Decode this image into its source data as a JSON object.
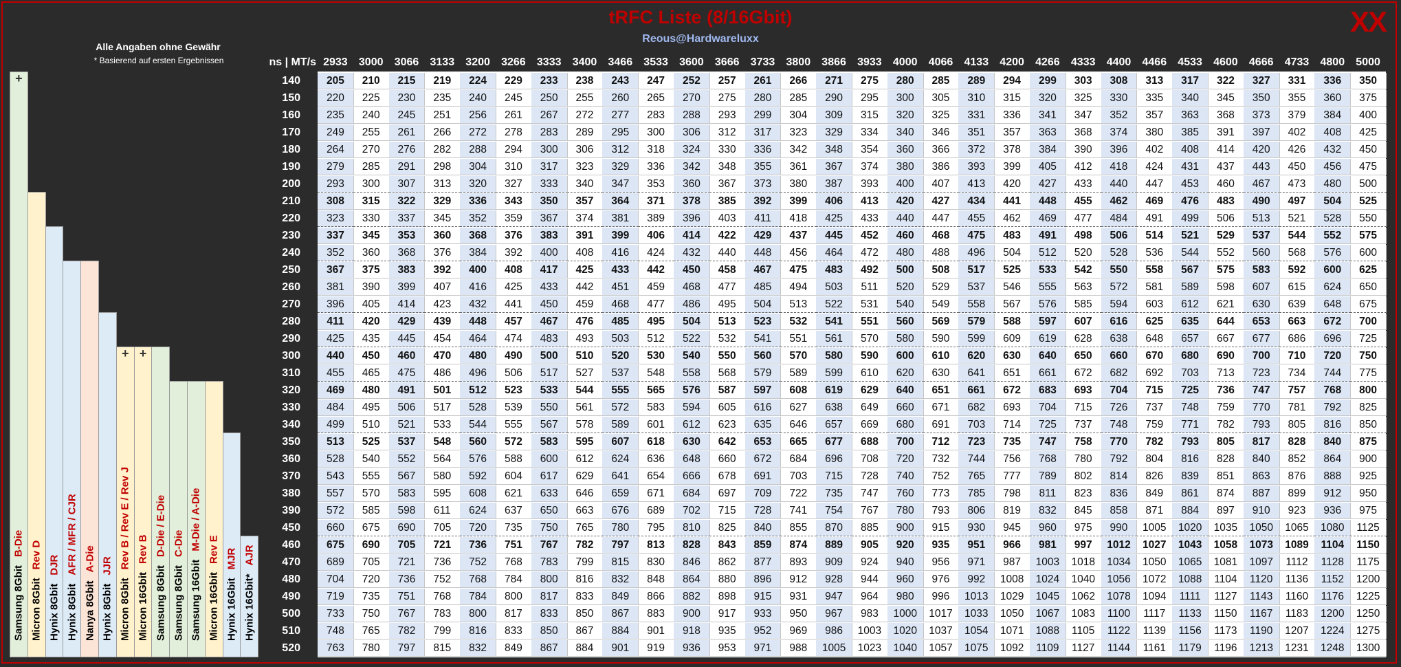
{
  "title": "tRFC Liste (8/16Gbit)",
  "subtitle": "Reous@Hardwareluxx",
  "corner_mark": "XX",
  "notes": {
    "line1": "Alle Angaben ohne Gewähr",
    "line2": "* Basierend auf ersten Ergebnissen"
  },
  "header_label": "ns | MT/s",
  "speeds": [
    "2933",
    "3000",
    "3066",
    "3133",
    "3200",
    "3266",
    "3333",
    "3400",
    "3466",
    "3533",
    "3600",
    "3666",
    "3733",
    "3800",
    "3866",
    "3933",
    "4000",
    "4066",
    "4133",
    "4200",
    "4266",
    "4333",
    "4400",
    "4466",
    "4533",
    "4600",
    "4666",
    "4733",
    "4800",
    "5000"
  ],
  "ns": [
    "140",
    "150",
    "160",
    "170",
    "180",
    "190",
    "200",
    "210",
    "220",
    "230",
    "240",
    "250",
    "260",
    "270",
    "280",
    "290",
    "300",
    "310",
    "320",
    "330",
    "340",
    "350",
    "360",
    "370",
    "380",
    "390",
    "450",
    "460",
    "470",
    "480",
    "490",
    "500",
    "510",
    "520"
  ],
  "bold_rows": [
    0,
    7,
    9,
    11,
    14,
    16,
    18,
    21,
    27
  ],
  "ics": [
    {
      "name": "Samsung 8Gbit",
      "die": "B-Die",
      "marker": "+",
      "color": "#e2efda"
    },
    {
      "name": "Micron 8Gbit",
      "die": "Rev D",
      "marker": "",
      "color": "#fff2cc"
    },
    {
      "name": "Hynix 8Gbit",
      "die": "DJR",
      "marker": "",
      "color": "#ddebf7"
    },
    {
      "name": "Hynix 8Gbit",
      "die": "AFR / MFR / CJR",
      "marker": "",
      "color": "#ddebf7"
    },
    {
      "name": "Nanya 8Gbit",
      "die": "A-Die",
      "marker": "",
      "color": "#fce4d6"
    },
    {
      "name": "Hynix 8Gbit",
      "die": "JJR",
      "marker": "",
      "color": "#ddebf7"
    },
    {
      "name": "Micron 8Gbit",
      "die": "Rev B / Rev E / Rev J",
      "marker": "+",
      "color": "#fff2cc"
    },
    {
      "name": "Micron 16Gbit",
      "die": "Rev B",
      "marker": "+",
      "color": "#fff2cc"
    },
    {
      "name": "Samsung 8Gbit",
      "die": "D-Die / E-Die",
      "marker": "",
      "color": "#e2efda"
    },
    {
      "name": "Samsung 8Gbit",
      "die": "C-Die",
      "marker": "",
      "color": "#e2efda"
    },
    {
      "name": "Samsung 16Gbit",
      "die": "M-Die / A-Die",
      "marker": "",
      "color": "#e2efda"
    },
    {
      "name": "Micron 16Gbit",
      "die": "Rev E",
      "marker": "",
      "color": "#fff2cc"
    },
    {
      "name": "Hynix 16Gbit",
      "die": "MJR",
      "marker": "",
      "color": "#ddebf7"
    },
    {
      "name": "Hynix 16Gbit*",
      "die": "AJR",
      "marker": "",
      "color": "#ddebf7"
    }
  ],
  "ic_start_rows": [
    0,
    7,
    9,
    11,
    11,
    14,
    16,
    16,
    16,
    18,
    18,
    18,
    21,
    27
  ],
  "values": [
    [
      "205",
      "210",
      "215",
      "219",
      "224",
      "229",
      "233",
      "238",
      "243",
      "247",
      "252",
      "257",
      "261",
      "266",
      "271",
      "275",
      "280",
      "285",
      "289",
      "294",
      "299",
      "303",
      "308",
      "313",
      "317",
      "322",
      "327",
      "331",
      "336",
      "350"
    ],
    [
      "220",
      "225",
      "230",
      "235",
      "240",
      "245",
      "250",
      "255",
      "260",
      "265",
      "270",
      "275",
      "280",
      "285",
      "290",
      "295",
      "300",
      "305",
      "310",
      "315",
      "320",
      "325",
      "330",
      "335",
      "340",
      "345",
      "350",
      "355",
      "360",
      "375"
    ],
    [
      "235",
      "240",
      "245",
      "251",
      "256",
      "261",
      "267",
      "272",
      "277",
      "283",
      "288",
      "293",
      "299",
      "304",
      "309",
      "315",
      "320",
      "325",
      "331",
      "336",
      "341",
      "347",
      "352",
      "357",
      "363",
      "368",
      "373",
      "379",
      "384",
      "400"
    ],
    [
      "249",
      "255",
      "261",
      "266",
      "272",
      "278",
      "283",
      "289",
      "295",
      "300",
      "306",
      "312",
      "317",
      "323",
      "329",
      "334",
      "340",
      "346",
      "351",
      "357",
      "363",
      "368",
      "374",
      "380",
      "385",
      "391",
      "397",
      "402",
      "408",
      "425"
    ],
    [
      "264",
      "270",
      "276",
      "282",
      "288",
      "294",
      "300",
      "306",
      "312",
      "318",
      "324",
      "330",
      "336",
      "342",
      "348",
      "354",
      "360",
      "366",
      "372",
      "378",
      "384",
      "390",
      "396",
      "402",
      "408",
      "414",
      "420",
      "426",
      "432",
      "450"
    ],
    [
      "279",
      "285",
      "291",
      "298",
      "304",
      "310",
      "317",
      "323",
      "329",
      "336",
      "342",
      "348",
      "355",
      "361",
      "367",
      "374",
      "380",
      "386",
      "393",
      "399",
      "405",
      "412",
      "418",
      "424",
      "431",
      "437",
      "443",
      "450",
      "456",
      "475"
    ],
    [
      "293",
      "300",
      "307",
      "313",
      "320",
      "327",
      "333",
      "340",
      "347",
      "353",
      "360",
      "367",
      "373",
      "380",
      "387",
      "393",
      "400",
      "407",
      "413",
      "420",
      "427",
      "433",
      "440",
      "447",
      "453",
      "460",
      "467",
      "473",
      "480",
      "500"
    ],
    [
      "308",
      "315",
      "322",
      "329",
      "336",
      "343",
      "350",
      "357",
      "364",
      "371",
      "378",
      "385",
      "392",
      "399",
      "406",
      "413",
      "420",
      "427",
      "434",
      "441",
      "448",
      "455",
      "462",
      "469",
      "476",
      "483",
      "490",
      "497",
      "504",
      "525"
    ],
    [
      "323",
      "330",
      "337",
      "345",
      "352",
      "359",
      "367",
      "374",
      "381",
      "389",
      "396",
      "403",
      "411",
      "418",
      "425",
      "433",
      "440",
      "447",
      "455",
      "462",
      "469",
      "477",
      "484",
      "491",
      "499",
      "506",
      "513",
      "521",
      "528",
      "550"
    ],
    [
      "337",
      "345",
      "353",
      "360",
      "368",
      "376",
      "383",
      "391",
      "399",
      "406",
      "414",
      "422",
      "429",
      "437",
      "445",
      "452",
      "460",
      "468",
      "475",
      "483",
      "491",
      "498",
      "506",
      "514",
      "521",
      "529",
      "537",
      "544",
      "552",
      "575"
    ],
    [
      "352",
      "360",
      "368",
      "376",
      "384",
      "392",
      "400",
      "408",
      "416",
      "424",
      "432",
      "440",
      "448",
      "456",
      "464",
      "472",
      "480",
      "488",
      "496",
      "504",
      "512",
      "520",
      "528",
      "536",
      "544",
      "552",
      "560",
      "568",
      "576",
      "600"
    ],
    [
      "367",
      "375",
      "383",
      "392",
      "400",
      "408",
      "417",
      "425",
      "433",
      "442",
      "450",
      "458",
      "467",
      "475",
      "483",
      "492",
      "500",
      "508",
      "517",
      "525",
      "533",
      "542",
      "550",
      "558",
      "567",
      "575",
      "583",
      "592",
      "600",
      "625"
    ],
    [
      "381",
      "390",
      "399",
      "407",
      "416",
      "425",
      "433",
      "442",
      "451",
      "459",
      "468",
      "477",
      "485",
      "494",
      "503",
      "511",
      "520",
      "529",
      "537",
      "546",
      "555",
      "563",
      "572",
      "581",
      "589",
      "598",
      "607",
      "615",
      "624",
      "650"
    ],
    [
      "396",
      "405",
      "414",
      "423",
      "432",
      "441",
      "450",
      "459",
      "468",
      "477",
      "486",
      "495",
      "504",
      "513",
      "522",
      "531",
      "540",
      "549",
      "558",
      "567",
      "576",
      "585",
      "594",
      "603",
      "612",
      "621",
      "630",
      "639",
      "648",
      "675"
    ],
    [
      "411",
      "420",
      "429",
      "439",
      "448",
      "457",
      "467",
      "476",
      "485",
      "495",
      "504",
      "513",
      "523",
      "532",
      "541",
      "551",
      "560",
      "569",
      "579",
      "588",
      "597",
      "607",
      "616",
      "625",
      "635",
      "644",
      "653",
      "663",
      "672",
      "700"
    ],
    [
      "425",
      "435",
      "445",
      "454",
      "464",
      "474",
      "483",
      "493",
      "503",
      "512",
      "522",
      "532",
      "541",
      "551",
      "561",
      "570",
      "580",
      "590",
      "599",
      "609",
      "619",
      "628",
      "638",
      "648",
      "657",
      "667",
      "677",
      "686",
      "696",
      "725"
    ],
    [
      "440",
      "450",
      "460",
      "470",
      "480",
      "490",
      "500",
      "510",
      "520",
      "530",
      "540",
      "550",
      "560",
      "570",
      "580",
      "590",
      "600",
      "610",
      "620",
      "630",
      "640",
      "650",
      "660",
      "670",
      "680",
      "690",
      "700",
      "710",
      "720",
      "750"
    ],
    [
      "455",
      "465",
      "475",
      "486",
      "496",
      "506",
      "517",
      "527",
      "537",
      "548",
      "558",
      "568",
      "579",
      "589",
      "599",
      "610",
      "620",
      "630",
      "641",
      "651",
      "661",
      "672",
      "682",
      "692",
      "703",
      "713",
      "723",
      "734",
      "744",
      "775"
    ],
    [
      "469",
      "480",
      "491",
      "501",
      "512",
      "523",
      "533",
      "544",
      "555",
      "565",
      "576",
      "587",
      "597",
      "608",
      "619",
      "629",
      "640",
      "651",
      "661",
      "672",
      "683",
      "693",
      "704",
      "715",
      "725",
      "736",
      "747",
      "757",
      "768",
      "800"
    ],
    [
      "484",
      "495",
      "506",
      "517",
      "528",
      "539",
      "550",
      "561",
      "572",
      "583",
      "594",
      "605",
      "616",
      "627",
      "638",
      "649",
      "660",
      "671",
      "682",
      "693",
      "704",
      "715",
      "726",
      "737",
      "748",
      "759",
      "770",
      "781",
      "792",
      "825"
    ],
    [
      "499",
      "510",
      "521",
      "533",
      "544",
      "555",
      "567",
      "578",
      "589",
      "601",
      "612",
      "623",
      "635",
      "646",
      "657",
      "669",
      "680",
      "691",
      "703",
      "714",
      "725",
      "737",
      "748",
      "759",
      "771",
      "782",
      "793",
      "805",
      "816",
      "850"
    ],
    [
      "513",
      "525",
      "537",
      "548",
      "560",
      "572",
      "583",
      "595",
      "607",
      "618",
      "630",
      "642",
      "653",
      "665",
      "677",
      "688",
      "700",
      "712",
      "723",
      "735",
      "747",
      "758",
      "770",
      "782",
      "793",
      "805",
      "817",
      "828",
      "840",
      "875"
    ],
    [
      "528",
      "540",
      "552",
      "564",
      "576",
      "588",
      "600",
      "612",
      "624",
      "636",
      "648",
      "660",
      "672",
      "684",
      "696",
      "708",
      "720",
      "732",
      "744",
      "756",
      "768",
      "780",
      "792",
      "804",
      "816",
      "828",
      "840",
      "852",
      "864",
      "900"
    ],
    [
      "543",
      "555",
      "567",
      "580",
      "592",
      "604",
      "617",
      "629",
      "641",
      "654",
      "666",
      "678",
      "691",
      "703",
      "715",
      "728",
      "740",
      "752",
      "765",
      "777",
      "789",
      "802",
      "814",
      "826",
      "839",
      "851",
      "863",
      "876",
      "888",
      "925"
    ],
    [
      "557",
      "570",
      "583",
      "595",
      "608",
      "621",
      "633",
      "646",
      "659",
      "671",
      "684",
      "697",
      "709",
      "722",
      "735",
      "747",
      "760",
      "773",
      "785",
      "798",
      "811",
      "823",
      "836",
      "849",
      "861",
      "874",
      "887",
      "899",
      "912",
      "950"
    ],
    [
      "572",
      "585",
      "598",
      "611",
      "624",
      "637",
      "650",
      "663",
      "676",
      "689",
      "702",
      "715",
      "728",
      "741",
      "754",
      "767",
      "780",
      "793",
      "806",
      "819",
      "832",
      "845",
      "858",
      "871",
      "884",
      "897",
      "910",
      "923",
      "936",
      "975"
    ],
    [
      "660",
      "675",
      "690",
      "705",
      "720",
      "735",
      "750",
      "765",
      "780",
      "795",
      "810",
      "825",
      "840",
      "855",
      "870",
      "885",
      "900",
      "915",
      "930",
      "945",
      "960",
      "975",
      "990",
      "1005",
      "1020",
      "1035",
      "1050",
      "1065",
      "1080",
      "1125"
    ],
    [
      "675",
      "690",
      "705",
      "721",
      "736",
      "751",
      "767",
      "782",
      "797",
      "813",
      "828",
      "843",
      "859",
      "874",
      "889",
      "905",
      "920",
      "935",
      "951",
      "966",
      "981",
      "997",
      "1012",
      "1027",
      "1043",
      "1058",
      "1073",
      "1089",
      "1104",
      "1150"
    ],
    [
      "689",
      "705",
      "721",
      "736",
      "752",
      "768",
      "783",
      "799",
      "815",
      "830",
      "846",
      "862",
      "877",
      "893",
      "909",
      "924",
      "940",
      "956",
      "971",
      "987",
      "1003",
      "1018",
      "1034",
      "1050",
      "1065",
      "1081",
      "1097",
      "1112",
      "1128",
      "1175"
    ],
    [
      "704",
      "720",
      "736",
      "752",
      "768",
      "784",
      "800",
      "816",
      "832",
      "848",
      "864",
      "880",
      "896",
      "912",
      "928",
      "944",
      "960",
      "976",
      "992",
      "1008",
      "1024",
      "1040",
      "1056",
      "1072",
      "1088",
      "1104",
      "1120",
      "1136",
      "1152",
      "1200"
    ],
    [
      "719",
      "735",
      "751",
      "768",
      "784",
      "800",
      "817",
      "833",
      "849",
      "866",
      "882",
      "898",
      "915",
      "931",
      "947",
      "964",
      "980",
      "996",
      "1013",
      "1029",
      "1045",
      "1062",
      "1078",
      "1094",
      "1111",
      "1127",
      "1143",
      "1160",
      "1176",
      "1225"
    ],
    [
      "733",
      "750",
      "767",
      "783",
      "800",
      "817",
      "833",
      "850",
      "867",
      "883",
      "900",
      "917",
      "933",
      "950",
      "967",
      "983",
      "1000",
      "1017",
      "1033",
      "1050",
      "1067",
      "1083",
      "1100",
      "1117",
      "1133",
      "1150",
      "1167",
      "1183",
      "1200",
      "1250"
    ],
    [
      "748",
      "765",
      "782",
      "799",
      "816",
      "833",
      "850",
      "867",
      "884",
      "901",
      "918",
      "935",
      "952",
      "969",
      "986",
      "1003",
      "1020",
      "1037",
      "1054",
      "1071",
      "1088",
      "1105",
      "1122",
      "1139",
      "1156",
      "1173",
      "1190",
      "1207",
      "1224",
      "1275"
    ],
    [
      "763",
      "780",
      "797",
      "815",
      "832",
      "849",
      "867",
      "884",
      "901",
      "919",
      "936",
      "953",
      "971",
      "988",
      "1005",
      "1023",
      "1040",
      "1057",
      "1075",
      "1092",
      "1109",
      "1127",
      "1144",
      "1161",
      "1179",
      "1196",
      "1213",
      "1231",
      "1248",
      "1300"
    ]
  ]
}
